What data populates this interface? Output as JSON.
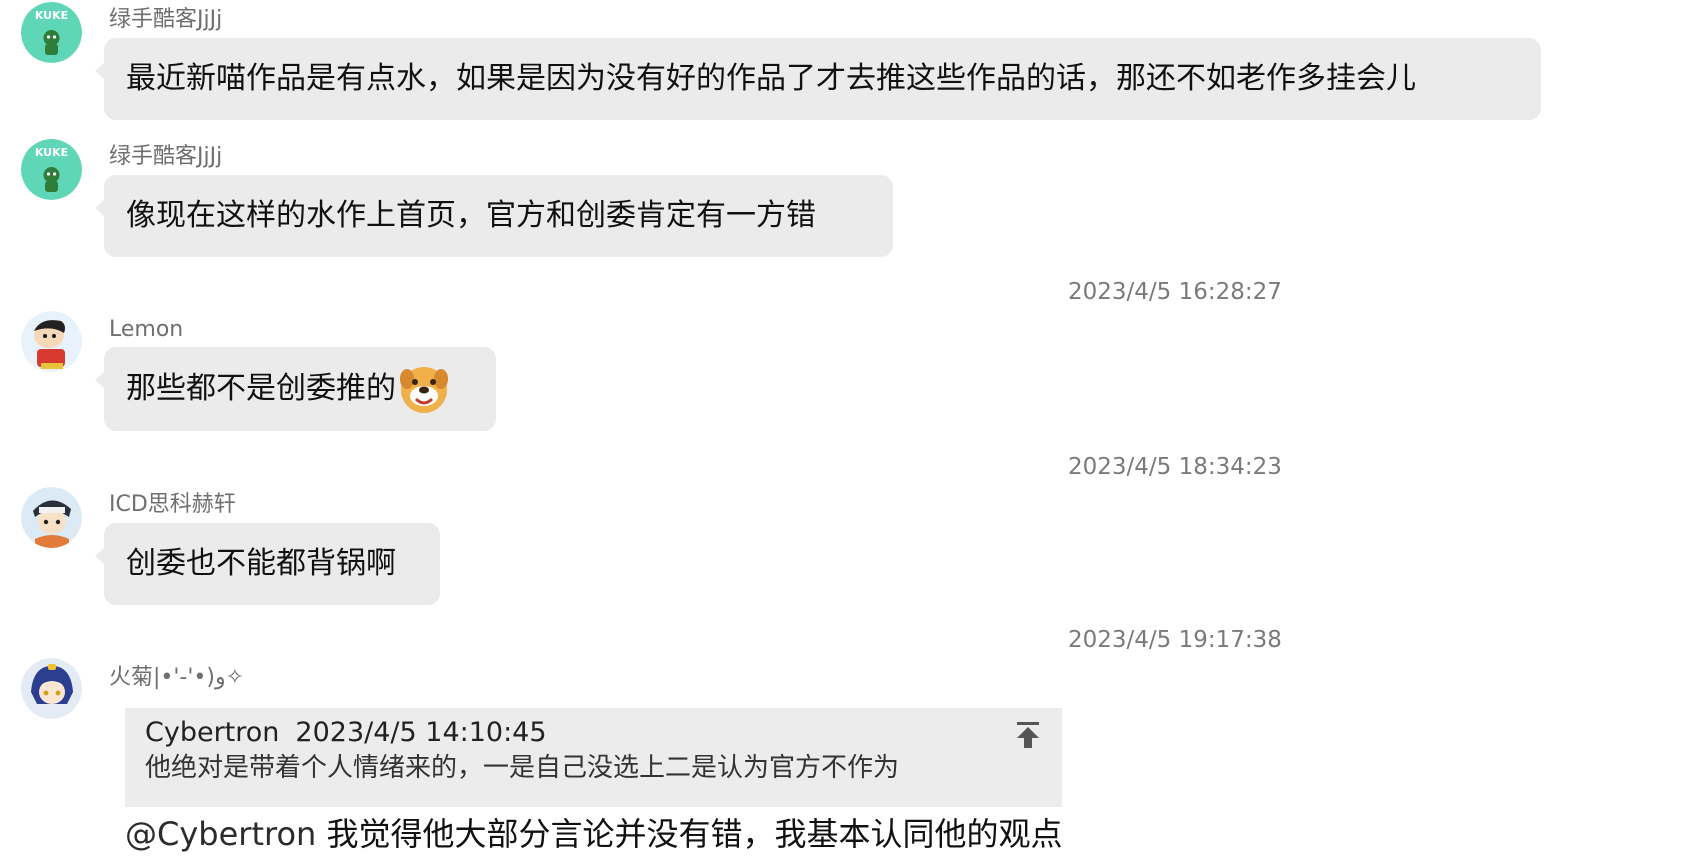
{
  "messages": [
    {
      "sender": "绿手酷客JjJj",
      "text": "最近新喵作品是有点水，如果是因为没有好的作品了才去推这些作品的话，那还不如老作多挂会儿",
      "avatar": "kuke-avatar"
    },
    {
      "sender": "绿手酷客JjJj",
      "text": "像现在这样的水作上首页，官方和创委肯定有一方错",
      "avatar": "kuke-avatar"
    },
    {
      "timestamp": "2023/4/5 16:28:27",
      "sender": "Lemon",
      "text": "那些都不是创委推的",
      "emoji": "dog-face-emoji",
      "avatar": "crayon-boy-avatar"
    },
    {
      "timestamp": "2023/4/5 18:34:23",
      "sender": "ICD思科赫轩",
      "text": "创委也不能都背锅啊",
      "avatar": "anime-boy-avatar"
    },
    {
      "timestamp": "2023/4/5 19:17:38",
      "sender": "火菊|•'-'•)و✧",
      "avatar": "anime-girl-avatar",
      "quote": {
        "author": "Cybertron",
        "time": "2023/4/5 14:10:45",
        "text": "他绝对是带着个人情绪来的，一是自己没选上二是认为官方不作为"
      },
      "mention": "@Cybertron",
      "text": "我觉得他大部分言论并没有错，我基本认同他的观点"
    }
  ],
  "colors": {
    "bubble": "#ebebeb",
    "sender": "#6f6f6f",
    "timestamp": "#7a7a7a",
    "kuke_bg": "#5fd6b6"
  }
}
